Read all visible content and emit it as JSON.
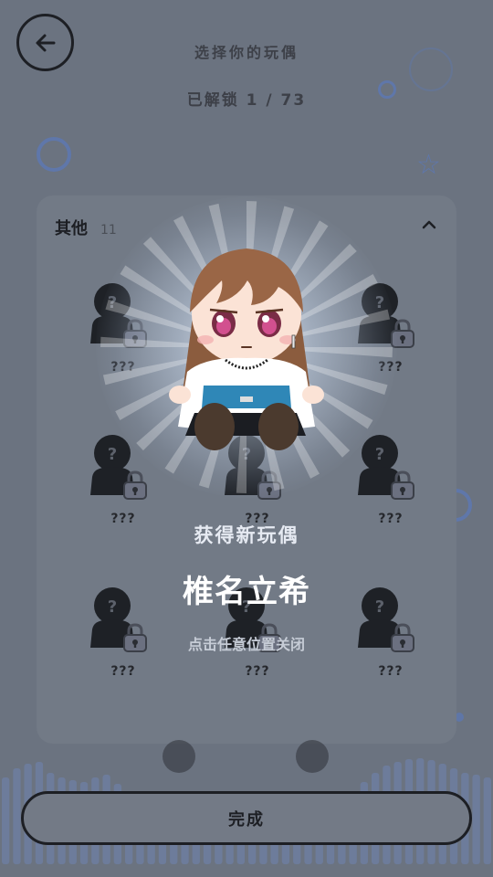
{
  "header": {
    "title": "选择你的玩偶",
    "progress": "已解锁 1 / 73"
  },
  "category": {
    "name": "其他",
    "count": "11",
    "expanded": true
  },
  "slots": {
    "locked_label": "???",
    "silhouette_mark": "?"
  },
  "modal": {
    "title": "获得新玩偶",
    "doll_name": "椎名立希",
    "hint": "点击任意位置关闭"
  },
  "footer": {
    "done_label": "完成"
  },
  "colors": {
    "background": "#6b7380",
    "accent_blue": "#5b78b8",
    "silhouette": "#1e2126"
  },
  "icons": [
    "back-arrow-icon",
    "chevron-up-icon",
    "lock-icon",
    "star-icon"
  ]
}
